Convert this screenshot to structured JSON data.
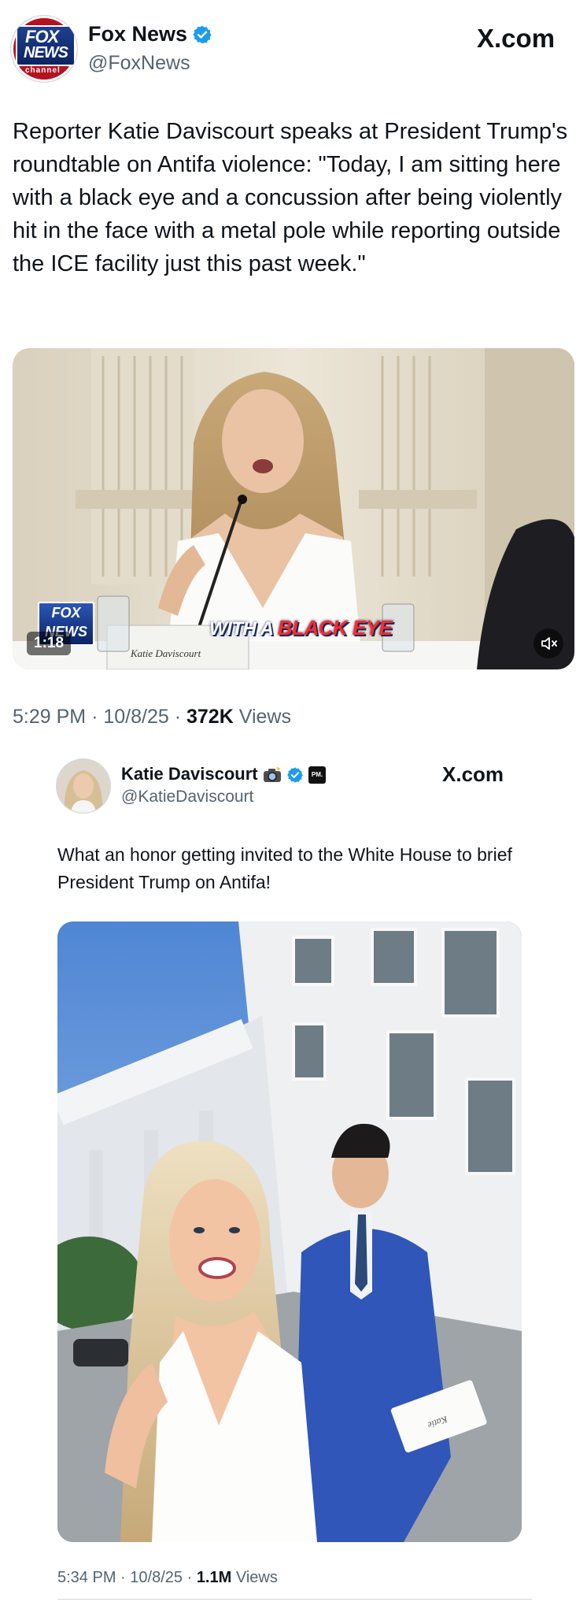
{
  "post1": {
    "avatar_lines": [
      "FOX",
      "NEWS",
      "channel"
    ],
    "display_name": "Fox News",
    "handle": "@FoxNews",
    "site_label": "X.com",
    "text": "Reporter Katie Daviscourt speaks at President Trump's roundtable on Antifa violence: \"Today, I am sitting here with a black eye and a concussion after being violently hit in the face with a metal pole while reporting outside the ICE facility just this past week.\"",
    "video": {
      "duration": "1:18",
      "chyron_lead": "WITH A",
      "chyron_emphasis": "BLACK EYE",
      "nameplate": "Katie Daviscourt",
      "bug_lines": [
        "FOX",
        "NEWS",
        "channel"
      ]
    },
    "time": "5:29 PM",
    "date": "10/8/25",
    "views_count": "372K",
    "views_label": "Views"
  },
  "post2": {
    "display_name": "Katie Daviscourt",
    "handle": "@KatieDaviscourt",
    "affiliate_badge": "PM.",
    "site_label": "X.com",
    "text": "What an honor getting invited to the White House to brief President Trump on Antifa!",
    "photo_card_text": "Katie",
    "time": "5:34 PM",
    "date": "10/8/25",
    "views_count": "1.1M",
    "views_label": "Views"
  },
  "separator": "·",
  "colors": {
    "verified_blue": "#1d9bf0",
    "text_primary": "#0f1419",
    "text_secondary": "#536471",
    "fox_red": "#b3121f",
    "fox_blue": "#0b2462"
  },
  "icons": [
    "verified-badge-icon",
    "camera-emoji-icon",
    "mute-icon",
    "fox-news-logo"
  ]
}
